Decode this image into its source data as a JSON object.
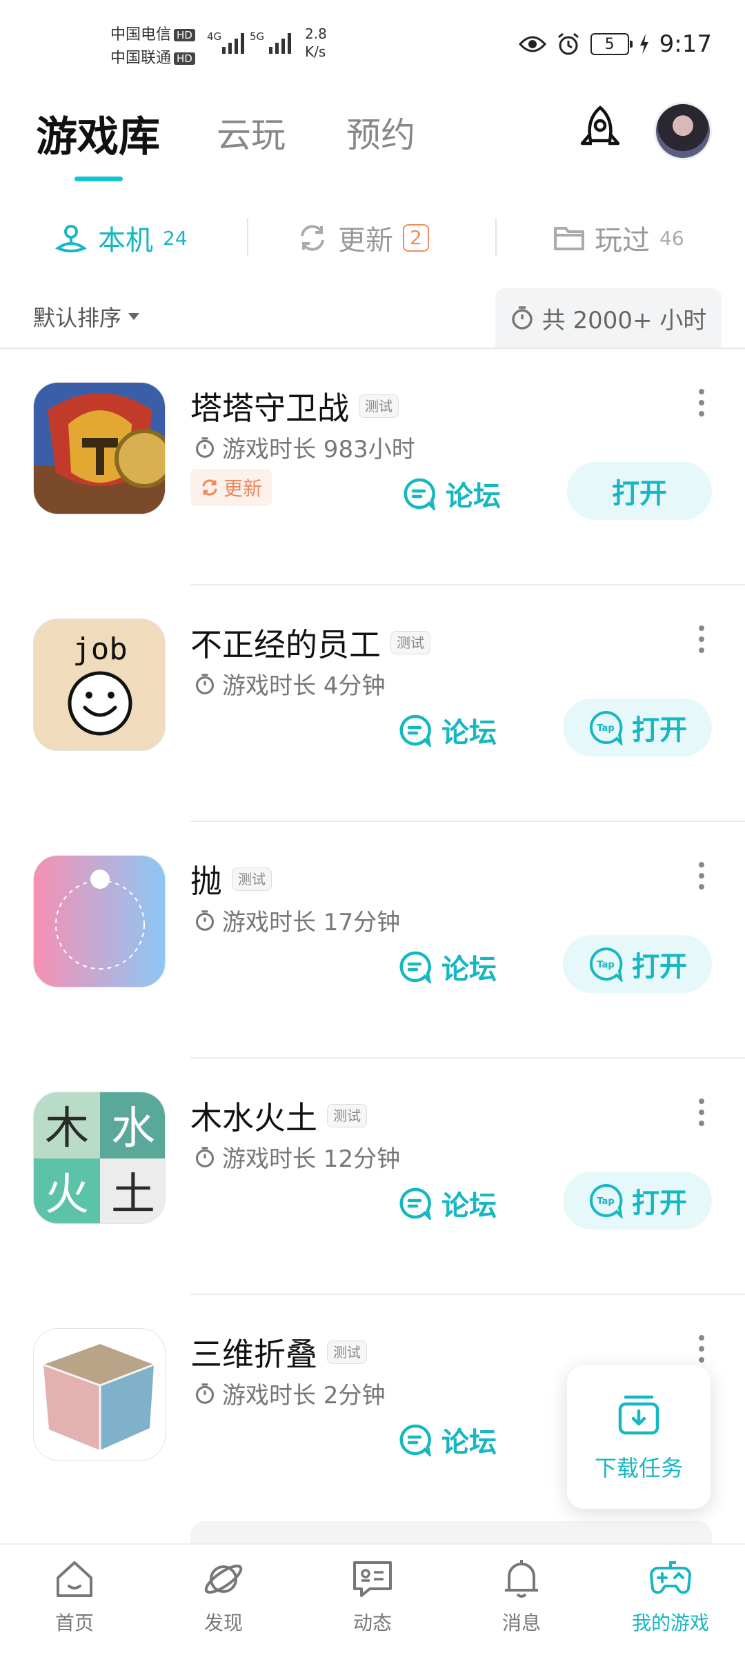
{
  "status_bar": {
    "carrier1": "中国电信",
    "carrier2": "中国联通",
    "hd": "HD",
    "net1": "4G",
    "net2": "5G",
    "speed_value": "2.8",
    "speed_unit": "K/s",
    "battery": "5",
    "time": "9:17"
  },
  "header": {
    "tabs": [
      {
        "label": "游戏库",
        "active": true
      },
      {
        "label": "云玩",
        "active": false
      },
      {
        "label": "预约",
        "active": false
      }
    ],
    "icons": [
      "rocket-icon",
      "avatar"
    ]
  },
  "subtabs": {
    "local": {
      "label": "本机",
      "count": "24",
      "icon": "device-icon"
    },
    "update": {
      "label": "更新",
      "badge": "2",
      "icon": "refresh-icon"
    },
    "played": {
      "label": "玩过",
      "count": "46",
      "icon": "folder-icon"
    }
  },
  "sort": {
    "label": "默认排序",
    "total_time": "共 2000+ 小时"
  },
  "games": [
    {
      "name": "塔塔守卫战",
      "tag": "测试",
      "time": "游戏时长 983小时",
      "update_label": "更新",
      "forum": "论坛",
      "open": "打开"
    },
    {
      "name": "不正经的员工",
      "tag": "测试",
      "time": "游戏时长 4分钟",
      "forum": "论坛",
      "open": "打开",
      "icon_text": "job"
    },
    {
      "name": "抛",
      "tag": "测试",
      "time": "游戏时长 17分钟",
      "forum": "论坛",
      "open": "打开"
    },
    {
      "name": "木水火土",
      "tag": "测试",
      "time": "游戏时长 12分钟",
      "forum": "论坛",
      "open": "打开",
      "icon_chars": [
        "木",
        "水",
        "火",
        "土"
      ]
    },
    {
      "name": "三维折叠",
      "tag": "测试",
      "time": "游戏时长 2分钟",
      "forum": "论坛"
    }
  ],
  "tap_label": "Tap",
  "download_task": "下载任务",
  "bottom_nav": [
    {
      "label": "首页",
      "icon": "home-icon"
    },
    {
      "label": "发现",
      "icon": "planet-icon"
    },
    {
      "label": "动态",
      "icon": "chat-icon"
    },
    {
      "label": "消息",
      "icon": "bell-icon"
    },
    {
      "label": "我的游戏",
      "icon": "gamepad-icon",
      "active": true
    }
  ],
  "colors": {
    "accent": "#15b7c2",
    "update": "#f08c5a"
  }
}
